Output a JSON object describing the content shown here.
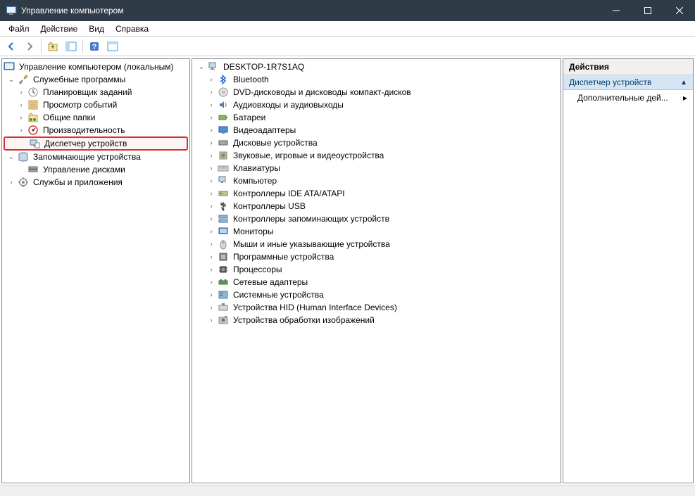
{
  "window": {
    "title": "Управление компьютером"
  },
  "menu": {
    "file": "Файл",
    "action": "Действие",
    "view": "Вид",
    "help": "Справка"
  },
  "left_tree": {
    "root": "Управление компьютером (локальным)",
    "system_tools": "Служебные программы",
    "task_scheduler": "Планировщик заданий",
    "event_viewer": "Просмотр событий",
    "shared_folders": "Общие папки",
    "performance": "Производительность",
    "device_manager": "Диспетчер устройств",
    "storage": "Запоминающие устройства",
    "disk_management": "Управление дисками",
    "services_apps": "Службы и приложения"
  },
  "device_tree": {
    "computer": "DESKTOP-1R7S1AQ",
    "items": [
      {
        "label": "Bluetooth",
        "icon": "bluetooth"
      },
      {
        "label": "DVD-дисководы и дисководы компакт-дисков",
        "icon": "dvd"
      },
      {
        "label": "Аудиовходы и аудиовыходы",
        "icon": "audio"
      },
      {
        "label": "Батареи",
        "icon": "battery"
      },
      {
        "label": "Видеоадаптеры",
        "icon": "display"
      },
      {
        "label": "Дисковые устройства",
        "icon": "disk"
      },
      {
        "label": "Звуковые, игровые и видеоустройства",
        "icon": "sound"
      },
      {
        "label": "Клавиатуры",
        "icon": "keyboard"
      },
      {
        "label": "Компьютер",
        "icon": "computer"
      },
      {
        "label": "Контроллеры IDE ATA/ATAPI",
        "icon": "ide"
      },
      {
        "label": "Контроллеры USB",
        "icon": "usb"
      },
      {
        "label": "Контроллеры запоминающих устройств",
        "icon": "storage-ctrl"
      },
      {
        "label": "Мониторы",
        "icon": "monitor"
      },
      {
        "label": "Мыши и иные указывающие устройства",
        "icon": "mouse"
      },
      {
        "label": "Программные устройства",
        "icon": "software"
      },
      {
        "label": "Процессоры",
        "icon": "cpu"
      },
      {
        "label": "Сетевые адаптеры",
        "icon": "network"
      },
      {
        "label": "Системные устройства",
        "icon": "system"
      },
      {
        "label": "Устройства HID (Human Interface Devices)",
        "icon": "hid"
      },
      {
        "label": "Устройства обработки изображений",
        "icon": "imaging"
      }
    ]
  },
  "actions": {
    "header": "Действия",
    "section": "Диспетчер устройств",
    "more": "Дополнительные дей..."
  }
}
